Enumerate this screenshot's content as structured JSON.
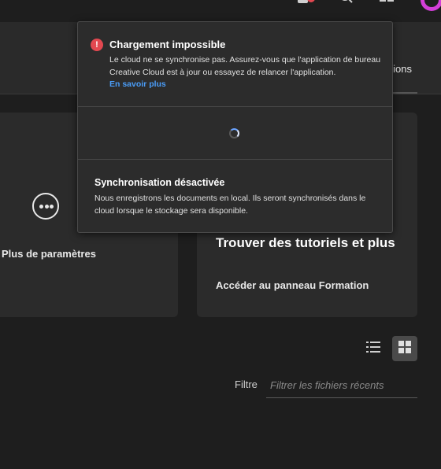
{
  "header": {
    "notification_icon": "notification-bell-icon",
    "search_icon": "search-icon",
    "apps_icon": "apps-grid-icon",
    "avatar_icon": "avatar-icon"
  },
  "strip": {
    "tab_label_partial": "ions"
  },
  "cards": {
    "more_settings": {
      "icon": "more-options-icon",
      "label": "Plus de paramètres"
    },
    "tutorials": {
      "title": "Trouver des tutoriels et plus",
      "link": "Accéder au panneau Formation"
    }
  },
  "view_toggle": {
    "list_icon": "list-view-icon",
    "grid_icon": "grid-view-icon",
    "active": "grid"
  },
  "filter": {
    "label": "Filtre",
    "placeholder": "Filtrer les fichiers récents",
    "value": ""
  },
  "popup": {
    "error": {
      "icon": "error-icon",
      "icon_glyph": "!",
      "title": "Chargement impossible",
      "body": "Le cloud ne se synchronise pas. Assurez-vous que l'application de bureau Creative Cloud est à jour ou essayez de relancer l'application.",
      "link": "En savoir plus"
    },
    "loading": {
      "icon": "loading-spinner-icon"
    },
    "sync": {
      "title": "Synchronisation désactivée",
      "body": "Nous enregistrons les documents en local. Ils seront synchronisés dans le cloud lorsque le stockage sera disponible."
    }
  },
  "colors": {
    "background": "#1e1e1e",
    "card": "#2b2b2b",
    "popup": "#2c2c2c",
    "error": "#e34850",
    "link": "#4a9df8",
    "accent_avatar": "#d43fd9"
  }
}
